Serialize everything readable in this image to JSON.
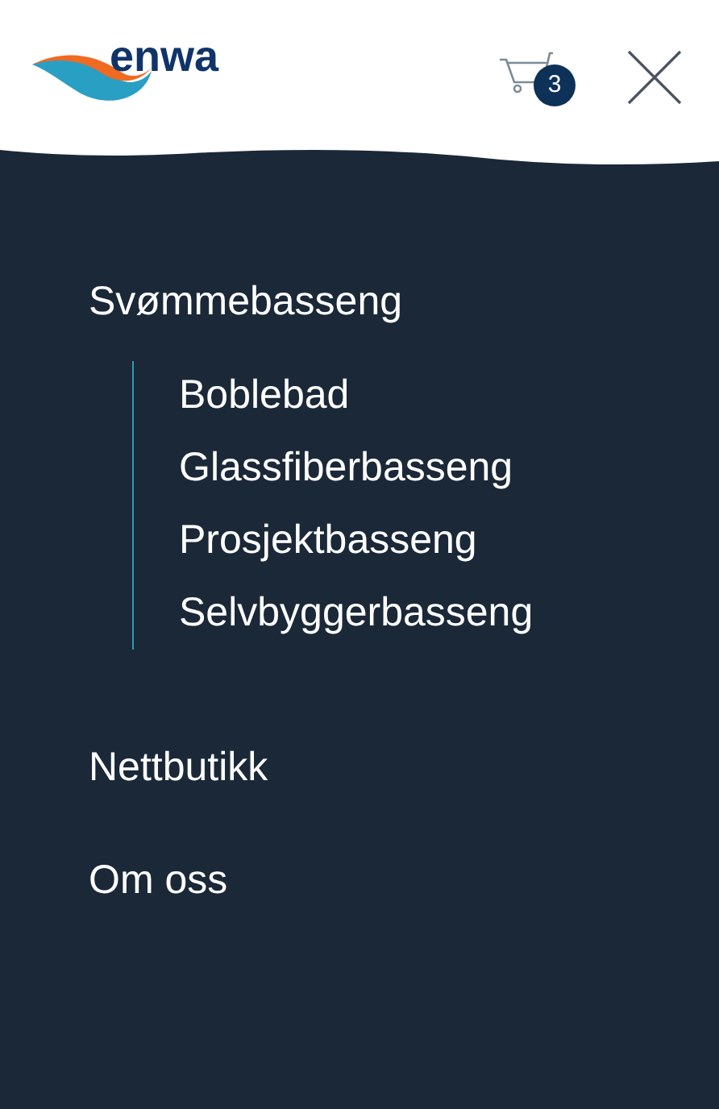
{
  "header": {
    "logo_text": "enwa",
    "cart": {
      "count": "3"
    }
  },
  "menu": [
    {
      "label": "Svømmebasseng",
      "expanded": true,
      "children": [
        {
          "label": "Boblebad"
        },
        {
          "label": "Glassfiberbasseng"
        },
        {
          "label": "Prosjektbasseng"
        },
        {
          "label": "Selvbyggerbasseng"
        }
      ]
    },
    {
      "label": "Nettbutikk"
    },
    {
      "label": "Om oss"
    }
  ]
}
